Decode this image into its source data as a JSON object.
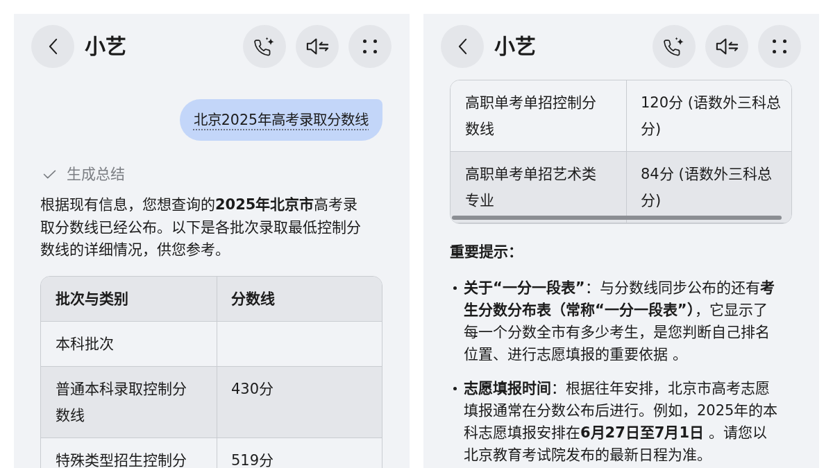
{
  "panels": [
    {
      "header": {
        "title": "小艺"
      },
      "content": [
        {
          "kind": "user_message",
          "text": "北京2025年高考录取分数线"
        },
        {
          "kind": "status",
          "text": "生成总结"
        },
        {
          "kind": "paragraph",
          "text": "根据现有信息，您想查询的**2025年北京市**高考录取分数线已经公布。以下是各批次录取最低控制分数线的详细情况，供您参考。"
        },
        {
          "kind": "table",
          "columns": [
            "批次与类别",
            "分数线"
          ],
          "rows": [
            [
              "本科批次"
            ],
            [
              "普通本科录取控制分数线",
              "430分"
            ],
            [
              "特殊类型招生控制分",
              "519分"
            ]
          ]
        }
      ]
    },
    {
      "header": {
        "title": "小艺"
      },
      "content": [
        {
          "kind": "table",
          "scrollbar": true,
          "rows": [
            [
              "高职单考单招控制分数线",
              "120分 (语数外三科总分)"
            ],
            [
              "高职单考单招艺术类专业",
              "84分 (语数外三科总分)"
            ]
          ]
        },
        {
          "kind": "heading",
          "text": "重要提示："
        },
        {
          "kind": "bullets",
          "items": [
            "**关于“一分一段表”**：与分数线同步公布的还有**考生分数分布表（常称“一分一段表”）**，它显示了每一个分数全市有多少考生，是您判断自己排名位置、进行志愿填报的重要依据 。",
            "**志愿填报时间**：根据往年安排，北京市高考志愿填报通常在分数公布后进行。例如，2025年的本科志愿填报安排在**6月27日至7月1日** 。请您以北京教育考试院发布的最新日程为准。"
          ]
        }
      ]
    }
  ]
}
